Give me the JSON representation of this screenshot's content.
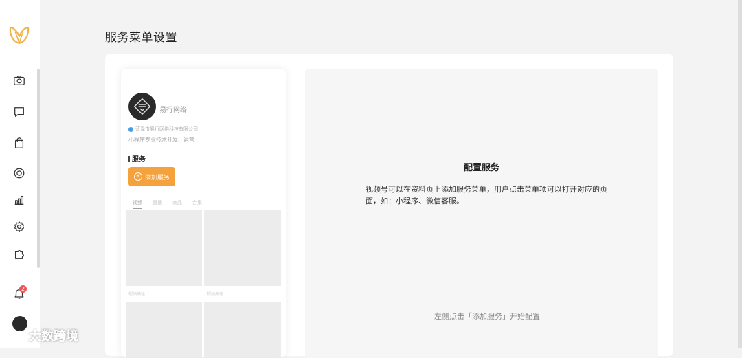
{
  "page": {
    "title": "服务菜单设置"
  },
  "sidebar": {
    "icons": [
      "camera-icon",
      "message-icon",
      "bag-icon",
      "target-icon",
      "chart-icon",
      "gear-icon",
      "puzzle-icon"
    ],
    "notification_count": "2"
  },
  "preview": {
    "profile_name": "易行网络",
    "verify_text": "菏泽市易行网络科技有限公司",
    "description": "小程序专业技术开发、运营",
    "service_title": "服务",
    "add_service_label": "添加服务",
    "tabs": [
      "视频",
      "直播",
      "商品",
      "合集"
    ],
    "cell_labels": [
      "视频描述",
      "视频描述"
    ]
  },
  "config": {
    "title": "配置服务",
    "description": "视频号可以在资料页上添加服务菜单，用户点击菜单项可以打开对应的页面，如：小程序、微信客服。",
    "hint": "左侧点击「添加服务」开始配置"
  },
  "watermark": {
    "text": "大数跨境"
  },
  "colors": {
    "accent": "#f5a13c",
    "badge": "#f05151",
    "logo": "#f0b44a"
  }
}
